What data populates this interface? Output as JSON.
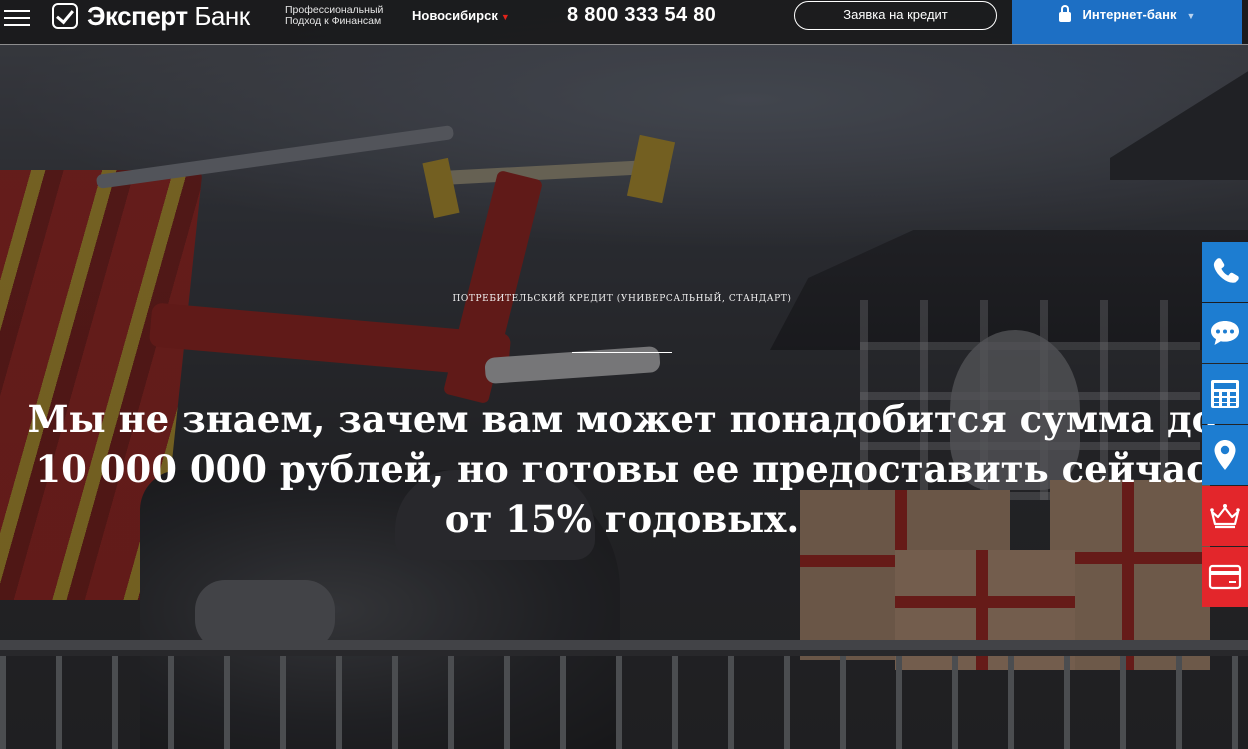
{
  "header": {
    "menu_icon": "hamburger-menu-icon",
    "logo": {
      "name_part1": "Эксперт",
      "name_part2": "Банк",
      "icon": "checkbox-check-icon"
    },
    "tagline_line1": "Профессиональный",
    "tagline_line2": "Подход к Финансам",
    "city": "Новосибирск",
    "phone": "8 800 333 54 80",
    "credit_button": "Заявка на кредит",
    "internet_bank": "Интернет-банк",
    "internet_bank_icon": "lock-icon"
  },
  "hero": {
    "eyebrow": "ПОТРЕБИТЕЛЬСКИЙ КРЕДИТ (УНИВЕРСАЛЬНЫЙ, СТАНДАРТ)",
    "headline_line1": "Мы не знаем, зачем вам может понадобится сумма до",
    "headline_line2": "10 000 000 рублей, но готовы ее предоставить сейчас",
    "headline_line3": "от 15% годовых."
  },
  "sidebar": [
    {
      "icon": "phone-icon",
      "color": "#1d7dd1"
    },
    {
      "icon": "chat-bubble-icon",
      "color": "#1d7dd1"
    },
    {
      "icon": "calculator-icon",
      "color": "#1d7dd1"
    },
    {
      "icon": "map-pin-icon",
      "color": "#1d7dd1"
    },
    {
      "icon": "crown-icon",
      "color": "#e3262b"
    },
    {
      "icon": "credit-card-icon",
      "color": "#e3262b"
    }
  ],
  "colors": {
    "accent_blue": "#1d6fc4",
    "accent_red": "#e2231a"
  }
}
